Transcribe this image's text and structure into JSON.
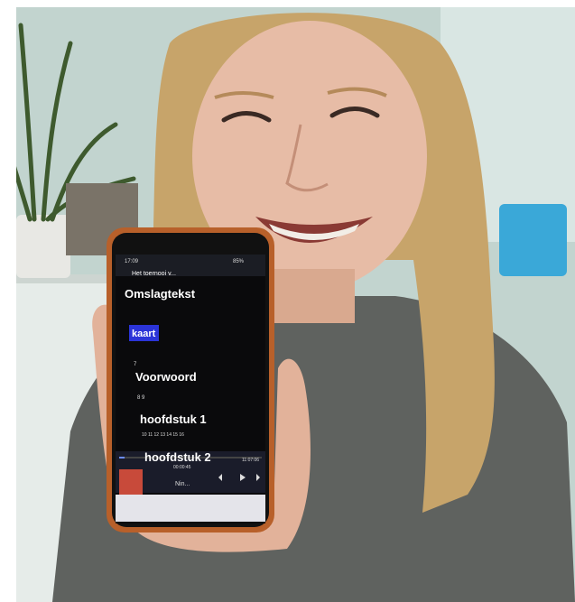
{
  "phone": {
    "status_time": "17:09",
    "status_battery": "85%",
    "appbar_title": "Het toernooi v...",
    "toc": [
      {
        "title": "Omslagtekst",
        "pages": ""
      },
      {
        "title": "kaart",
        "pages": "7",
        "highlighted": true
      },
      {
        "title": "Voorwoord",
        "pages": "8 9"
      },
      {
        "title": "hoofdstuk 1",
        "pages": "10 11 12 13 14 15 16"
      },
      {
        "title": "hoofdstuk 2",
        "pages": ""
      }
    ],
    "player": {
      "elapsed": "00:00:45",
      "total": "11:07:06",
      "track_label": "Nin..."
    }
  },
  "colors": {
    "phone_case": "#b8602a",
    "screen_bg": "#0a0a0c",
    "highlight": "#2b34d8",
    "player_bar": "#1a1c2a"
  }
}
